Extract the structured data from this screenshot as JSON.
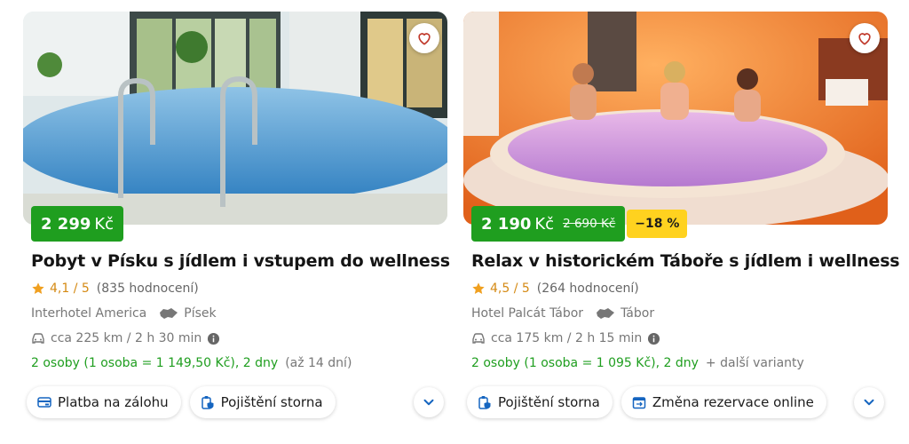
{
  "colors": {
    "price_green": "#1f9e1f",
    "discount_yellow": "#ffd21f",
    "rating_orange": "#d58a14",
    "chevron_blue": "#1565c0"
  },
  "cards": [
    {
      "price": "2 299",
      "currency": "Kč",
      "title": "Pobyt v Písku s jídlem i vstupem do wellness",
      "rating_score": "4,1 / 5",
      "rating_count": "(835 hodnocení)",
      "hotel": "Interhotel America",
      "city": "Písek",
      "distance": "cca 225 km / 2 h 30 min",
      "stay": "2 osoby (1 osoba = 1 149,50 Kč), 2 dny",
      "stay_extra": "(až 14 dní)",
      "chips": [
        "Platba na zálohu",
        "Pojištění storna"
      ],
      "icons": {
        "favorite": "heart-icon",
        "rating": "star-icon",
        "map": "czech-map-icon",
        "distance": "car-icon",
        "info": "info-icon",
        "expand": "chevron-down-icon"
      }
    },
    {
      "price": "2 190",
      "currency": "Kč",
      "old_price": "2 690 Kč",
      "discount": "−18 %",
      "title": "Relax v historickém Táboře s jídlem i wellness",
      "rating_score": "4,5 / 5",
      "rating_count": "(264 hodnocení)",
      "hotel": "Hotel Palcát Tábor",
      "city": "Tábor",
      "distance": "cca 175 km / 2 h 15 min",
      "stay": "2 osoby (1 osoba = 1 095 Kč), 2 dny",
      "stay_extra": "+  další varianty",
      "chips": [
        "Pojištění storna",
        "Změna rezervace online"
      ],
      "icons": {
        "favorite": "heart-icon",
        "rating": "star-icon",
        "map": "czech-map-icon",
        "distance": "car-icon",
        "info": "info-icon",
        "expand": "chevron-down-icon"
      }
    }
  ]
}
